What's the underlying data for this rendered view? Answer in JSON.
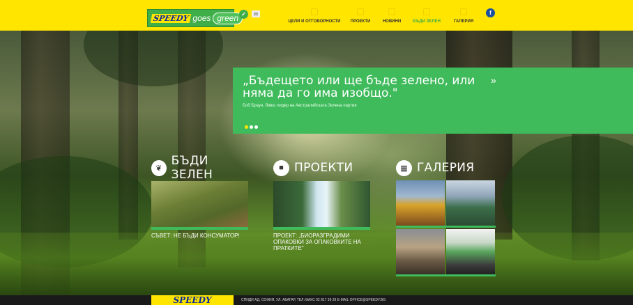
{
  "header": {
    "logo": {
      "brand": "SPEEDY",
      "goes": "goes",
      "green": "green"
    },
    "eco_icon": "eco-leaf-icon",
    "mail_icon": "mail-icon",
    "facebook_icon": "facebook-icon",
    "facebook_letter": "f",
    "nav": [
      {
        "label": "ЦЕЛИ И ОТГОВОРНОСТИ",
        "icon": "target-icon",
        "active": false
      },
      {
        "label": "ПРОЕКТИ",
        "icon": "projects-icon",
        "active": false
      },
      {
        "label": "НОВИНИ",
        "icon": "news-icon",
        "active": false
      },
      {
        "label": "БЪДИ ЗЕЛЕН",
        "icon": "leaf-icon",
        "active": true
      },
      {
        "label": "ГАЛЕРИЯ",
        "icon": "gallery-icon",
        "active": false
      }
    ]
  },
  "quote": {
    "text": "„Бъдещето или ще бъде зелено, или няма да го има изобщо.\"",
    "author": "Боб Браун, бивш лидер на Австралийската Зелена партия",
    "next": "»",
    "slides": 3,
    "active_slide": 1
  },
  "sections": {
    "be_green": {
      "title": "БЪДИ ЗЕЛЕН",
      "icon": "leaf-icon",
      "caption": "СЪВЕТ: НЕ БЪДИ КОНСУМАТОР!"
    },
    "projects": {
      "title": "ПРОЕКТИ",
      "icon": "truck-icon",
      "caption": "ПРОЕКТ: „БИОРАЗГРАДИМИ ОПАКОВКИ ЗА ОПАКОВКИТЕ НА ПРАТКИТЕ\""
    },
    "gallery": {
      "title": "ГАЛЕРИЯ",
      "icon": "grid-icon"
    }
  },
  "footer": {
    "logo": "SPEEDY",
    "text": "СПИДИ АД, СОФИЯ, УЛ. АБАГАР, ТЕЛ./ФАКС 02 817 39 29 E-MAIL OFFICE@SPEEDY.BG"
  },
  "colors": {
    "yellow": "#ffe500",
    "green": "#3fbb5c",
    "blue": "#0b2a9a"
  }
}
